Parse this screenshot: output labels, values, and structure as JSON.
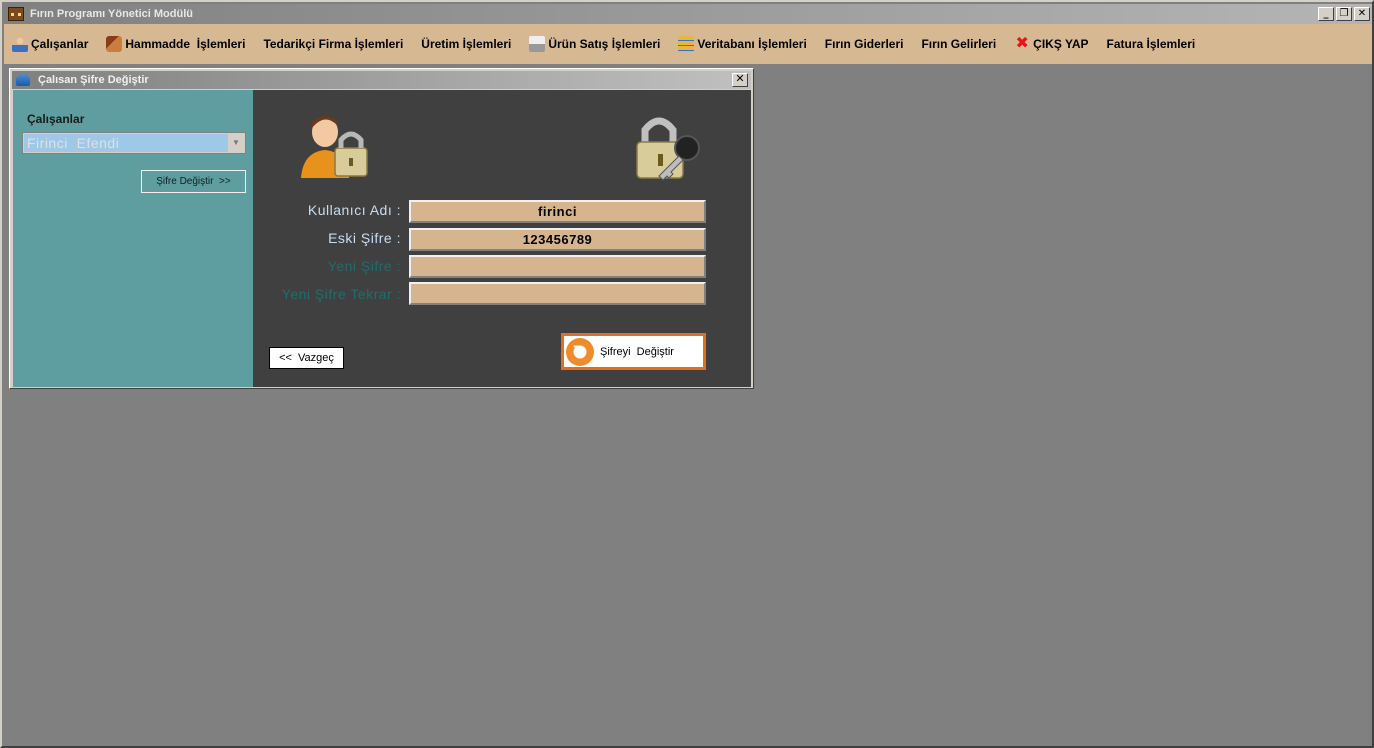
{
  "window": {
    "title": "Fırın Programı Yönetici Modülü"
  },
  "window_controls": {
    "minimize": "_",
    "restore": "❐",
    "close": "✕"
  },
  "menu": {
    "items": [
      {
        "label": "Çalışanlar",
        "icon": "user-icon"
      },
      {
        "label": "Hammadde  İşlemleri",
        "icon": "raw-material-icon"
      },
      {
        "label": "Tedarikçi Firma İşlemleri",
        "icon": ""
      },
      {
        "label": "Üretim İşlemleri",
        "icon": ""
      },
      {
        "label": "Ürün Satış İşlemleri",
        "icon": "sales-icon"
      },
      {
        "label": "Veritabanı İşlemleri",
        "icon": "database-icon"
      },
      {
        "label": "Fırın Giderleri",
        "icon": ""
      },
      {
        "label": "Fırın Gelirleri",
        "icon": ""
      },
      {
        "label": "ÇIKŞ YAP",
        "icon": "exit-icon"
      },
      {
        "label": "Fatura İşlemleri",
        "icon": ""
      }
    ]
  },
  "dialog": {
    "title": "Çalısan Şifre Değiştir",
    "close": "✕",
    "left": {
      "employees_label": "Çalışanlar",
      "selected_employee": "Firinci  Efendi",
      "change_button": "Şifre Değiştir  >>"
    },
    "form": {
      "username_label": "Kullanıcı Adı :",
      "username_value": "firinci",
      "old_password_label": "Eski Şifre :",
      "old_password_value": "123456789",
      "new_password_label": "Yeni Şifre :",
      "new_password_value": "",
      "new_password_repeat_label": "Yeni Şifre Tekrar :",
      "new_password_repeat_value": ""
    },
    "buttons": {
      "cancel": "<<  Vazgeç",
      "submit": "Şifreyi  Değiştir"
    }
  },
  "colors": {
    "menubar": "#d6b993",
    "left_panel": "#5f9ea0",
    "right_panel": "#404040",
    "field_bg": "#d6b48e",
    "submit_border": "#e07020"
  }
}
